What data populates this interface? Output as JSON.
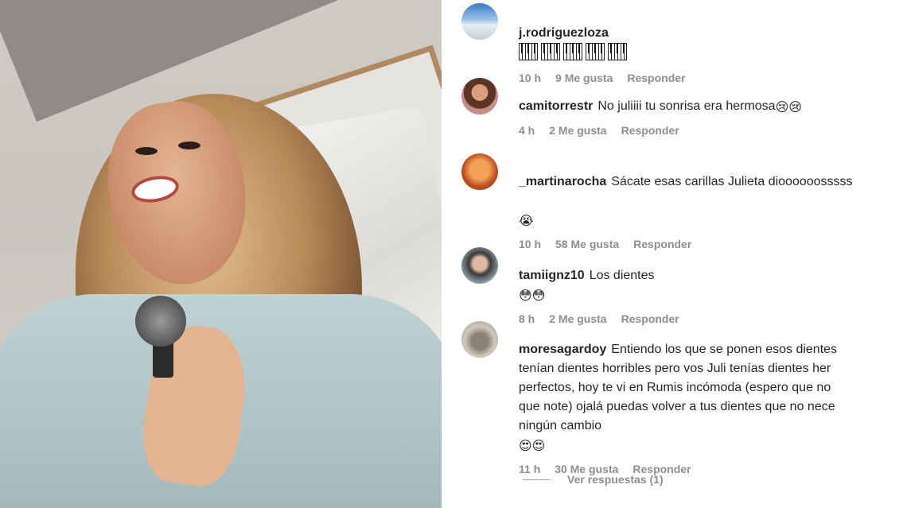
{
  "comments": [
    {
      "username": "j.rodriguezloza",
      "text": "",
      "emoji": "🎹🎹🎹🎹🎹",
      "time": "10 h",
      "likes": "9 Me gusta",
      "reply": "Responder"
    },
    {
      "username": "camitorrestr",
      "text": "No juliiii tu sonrisa era hermosa",
      "emoji": "😢😢",
      "time": "4 h",
      "likes": "2 Me gusta",
      "reply": "Responder"
    },
    {
      "username": "_martinarocha",
      "text": "Sácate esas carillas Julieta dioooooosssss",
      "emoji": "😭",
      "time": "10 h",
      "likes": "58 Me gusta",
      "reply": "Responder"
    },
    {
      "username": "tamiignz10",
      "text": "Los dientes",
      "emoji": "😳😳",
      "time": "8 h",
      "likes": "2 Me gusta",
      "reply": "Responder"
    },
    {
      "username": "moresagardoy",
      "text": "Entiendo los que se ponen esos dientes\ntenían dientes horribles pero vos Juli tenías dientes her\nperfectos, hoy te vi en Rumis incómoda (espero que no\nque note) ojalá puedas volver a tus dientes que no nece\nningún cambio",
      "emoji": "😍😍",
      "time": "11 h",
      "likes": "30 Me gusta",
      "reply": "Responder"
    }
  ],
  "view_replies": "Ver respuestas (1)",
  "colors": {
    "text": "#262626",
    "meta": "#8e8e8e"
  }
}
